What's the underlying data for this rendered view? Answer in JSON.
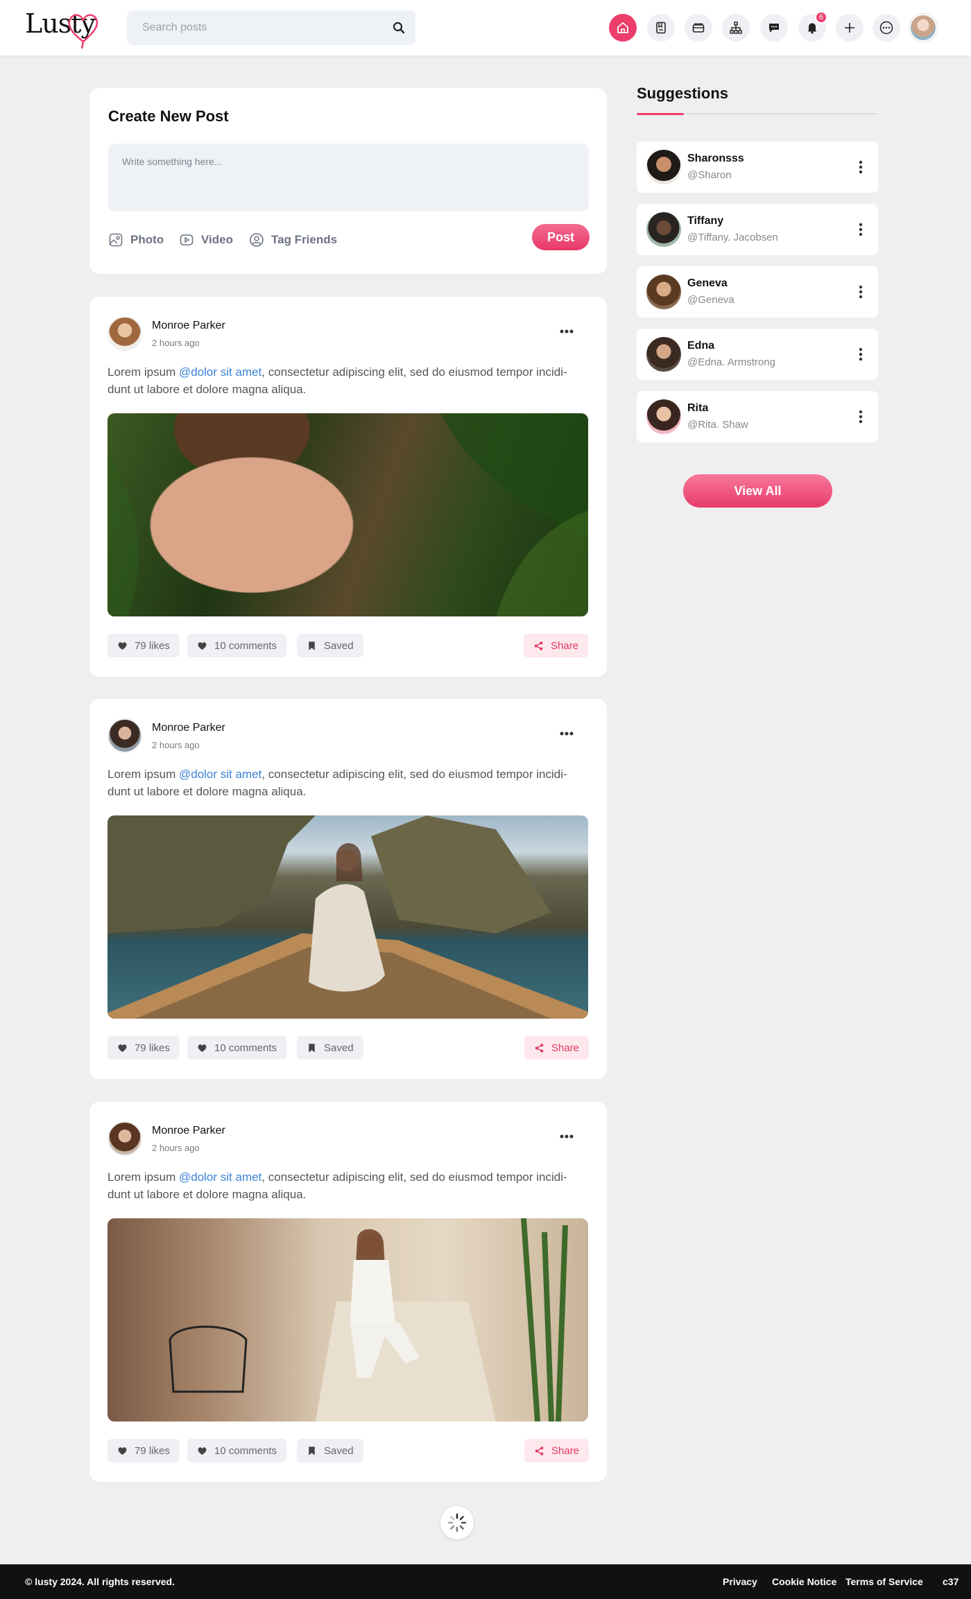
{
  "brand": {
    "name": "Lusty"
  },
  "search": {
    "placeholder": "Search posts"
  },
  "header": {
    "nav_icons": [
      "home-icon",
      "bookmark-icon",
      "cards-icon",
      "sitemap-icon",
      "chat-icon",
      "bell-icon",
      "plus-icon",
      "more-icon"
    ],
    "notification_count": "6",
    "accent": "#ec3d6b"
  },
  "create_post": {
    "title": "Create New Post",
    "placeholder": "Write something here...",
    "photo_label": "Photo",
    "video_label": "Video",
    "tag_label": "Tag Friends",
    "post_label": "Post"
  },
  "posts": [
    {
      "author": "Monroe Parker",
      "time": "2 hours ago",
      "text_before": "Lorem ipsum ",
      "mention": "@dolor sit amet",
      "text_after": ", consectetur adipiscing elit, sed do eiusmod tempor incidi-dunt ut labore et dolore magna aliqua.",
      "likes": "79 likes",
      "comments": "10 comments",
      "saved": "Saved",
      "share": "Share"
    },
    {
      "author": "Monroe Parker",
      "time": "2 hours ago",
      "text_before": "Lorem ipsum ",
      "mention": "@dolor sit amet",
      "text_after": ", consectetur adipiscing elit, sed do eiusmod tempor incidi-dunt ut labore et dolore magna aliqua.",
      "likes": "79 likes",
      "comments": "10 comments",
      "saved": "Saved",
      "share": "Share"
    },
    {
      "author": "Monroe Parker",
      "time": "2 hours ago",
      "text_before": "Lorem ipsum ",
      "mention": "@dolor sit amet",
      "text_after": ", consectetur adipiscing elit, sed do eiusmod tempor incidi-dunt ut labore et dolore magna aliqua.",
      "likes": "79 likes",
      "comments": "10 comments",
      "saved": "Saved",
      "share": "Share"
    }
  ],
  "suggestions": {
    "title": "Suggestions",
    "items": [
      {
        "name": "Sharonsss",
        "handle": "@Sharon"
      },
      {
        "name": "Tiffany",
        "handle": "@Tiffany. Jacobsen"
      },
      {
        "name": "Geneva",
        "handle": "@Geneva"
      },
      {
        "name": "Edna",
        "handle": "@Edna. Armstrong"
      },
      {
        "name": "Rita",
        "handle": "@Rita. Shaw"
      }
    ],
    "view_all": "View All"
  },
  "footer": {
    "copyright": "© lusty 2024. All rights reserved.",
    "links": [
      "Privacy",
      "Cookie Notice",
      "Terms of Service",
      "c37"
    ]
  }
}
